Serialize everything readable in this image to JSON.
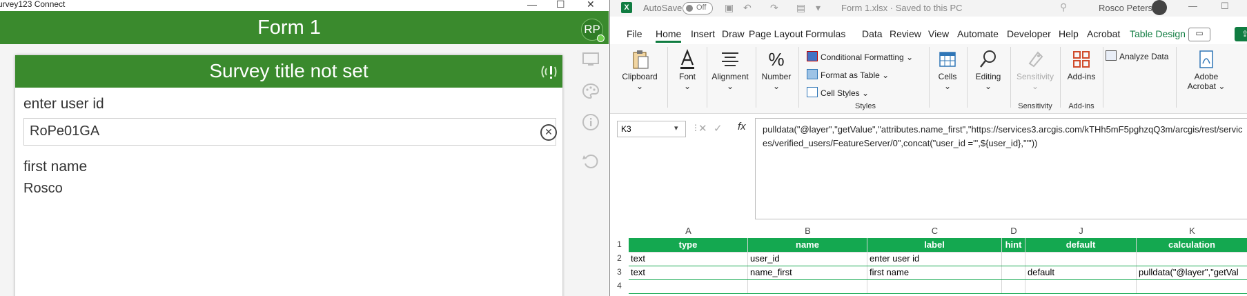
{
  "survey_app": {
    "window_title": "urvey123 Connect",
    "form_title": "Form 1",
    "avatar_initials": "RP",
    "survey_title": "Survey title not set",
    "questions": [
      {
        "label": "enter user id",
        "value": "RoPe01GA"
      },
      {
        "label": "first name",
        "value": "Rosco"
      }
    ],
    "side_icons": [
      "monitor-icon",
      "palette-icon",
      "info-icon",
      "undo-icon"
    ]
  },
  "excel": {
    "autosave_label": "AutoSave",
    "autosave_state": "Off",
    "doc_title": "Form 1.xlsx · Saved to this PC",
    "user_name": "Rosco Peters",
    "tabs": [
      "File",
      "Home",
      "Insert",
      "Draw",
      "Page Layout",
      "Formulas",
      "Data",
      "Review",
      "View",
      "Automate",
      "Developer",
      "Help",
      "Acrobat",
      "Table Design"
    ],
    "active_tab": "Home",
    "ribbon": {
      "clipboard": "Clipboard",
      "font": "Font",
      "alignment": "Alignment",
      "number": "Number",
      "conditional_formatting": "Conditional Formatting",
      "format_as_table": "Format as Table",
      "cell_styles": "Cell Styles",
      "styles_group": "Styles",
      "cells": "Cells",
      "editing": "Editing",
      "sensitivity": "Sensitivity",
      "sensitivity_group": "Sensitivity",
      "addins": "Add-ins",
      "addins_group": "Add-ins",
      "analyze_data": "Analyze Data",
      "adobe_acrobat_1": "Adobe",
      "adobe_acrobat_2": "Acrobat"
    },
    "name_box": "K3",
    "formula": "pulldata(\"@layer\",\"getValue\",\"attributes.name_first\",\"https://services3.arcgis.com/kTHh5mF5pghzqQ3m/arcgis/rest/services/verified_users/FeatureServer/0\",concat(\"user_id ='\",${user_id},\"'\"))",
    "columns": [
      "A",
      "B",
      "C",
      "D",
      "J",
      "K"
    ],
    "rows": [
      [
        "type",
        "name",
        "label",
        "hint",
        "default",
        "calculation"
      ],
      [
        "text",
        "user_id",
        "enter user id",
        "",
        "",
        ""
      ],
      [
        "text",
        "name_first",
        "first name",
        "",
        "default",
        "pulldata(\"@layer\",\"getVal"
      ],
      [
        "",
        "",
        "",
        "",
        "",
        ""
      ]
    ],
    "row_numbers": [
      "1",
      "2",
      "3",
      "4"
    ]
  }
}
